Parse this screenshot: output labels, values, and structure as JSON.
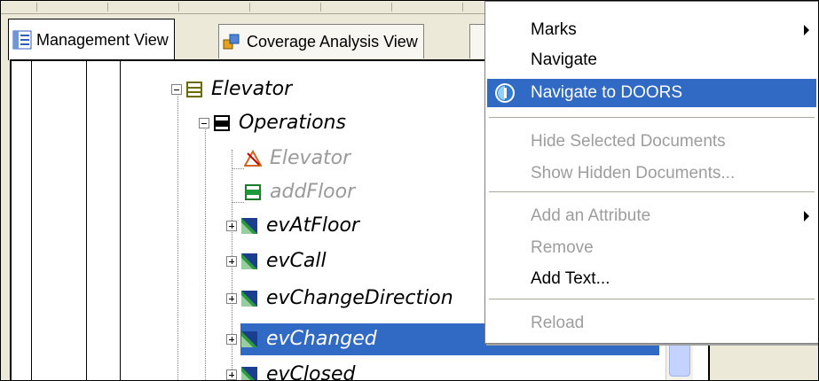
{
  "tabs": [
    {
      "label": "Management View",
      "icon": "management-view-icon",
      "active": true
    },
    {
      "label": "Coverage Analysis View",
      "icon": "coverage-analysis-icon",
      "active": false
    }
  ],
  "tree": {
    "nodes": [
      {
        "label": "Elevator",
        "icon": "class-icon",
        "expander": "minus",
        "disabled": false,
        "selected": false
      },
      {
        "label": "Operations",
        "icon": "operations-folder-icon",
        "expander": "minus",
        "disabled": false,
        "selected": false
      },
      {
        "label": "Elevator",
        "icon": "constructor-icon",
        "expander": "",
        "disabled": true,
        "selected": false
      },
      {
        "label": "addFloor",
        "icon": "operation-icon",
        "expander": "",
        "disabled": true,
        "selected": false
      },
      {
        "label": "evAtFloor",
        "icon": "event-icon",
        "expander": "plus",
        "disabled": false,
        "selected": false
      },
      {
        "label": "evCall",
        "icon": "event-icon",
        "expander": "plus",
        "disabled": false,
        "selected": false
      },
      {
        "label": "evChangeDirection",
        "icon": "event-icon",
        "expander": "plus",
        "disabled": false,
        "selected": false
      },
      {
        "label": "evChanged",
        "icon": "event-icon",
        "expander": "plus",
        "disabled": false,
        "selected": true
      },
      {
        "label": "evClosed",
        "icon": "event-icon",
        "expander": "plus",
        "disabled": false,
        "selected": false
      }
    ]
  },
  "context_menu": {
    "items": [
      {
        "label": "Marks",
        "submenu": true,
        "disabled": false,
        "highlighted": false
      },
      {
        "label": "Navigate",
        "submenu": false,
        "disabled": false,
        "highlighted": false
      },
      {
        "label": "Navigate to DOORS",
        "submenu": false,
        "disabled": false,
        "highlighted": true,
        "icon": "doors-icon"
      },
      {
        "label": "Hide Selected Documents",
        "submenu": false,
        "disabled": true,
        "highlighted": false
      },
      {
        "label": "Show Hidden Documents...",
        "submenu": false,
        "disabled": true,
        "highlighted": false
      },
      {
        "label": "Add an Attribute",
        "submenu": true,
        "disabled": true,
        "highlighted": false
      },
      {
        "label": "Remove",
        "submenu": false,
        "disabled": true,
        "highlighted": false
      },
      {
        "label": "Add Text...",
        "submenu": false,
        "disabled": false,
        "highlighted": false
      },
      {
        "label": "Reload",
        "submenu": false,
        "disabled": true,
        "highlighted": false
      }
    ]
  },
  "colors": {
    "selection": "#316ac5",
    "disabled_text": "#9d9d9d",
    "window_bg": "#ece9d8"
  }
}
